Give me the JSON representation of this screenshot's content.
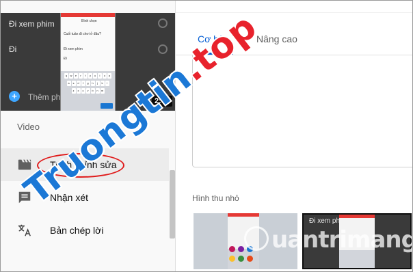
{
  "video_preview": {
    "duration": "2:09",
    "bg_title": "Đi xem phim",
    "bg_text": "Đi",
    "add_label": "Thêm phim",
    "phone": {
      "header": "Bình chọn",
      "question": "Cuối tuần đi chơi ở đâu?",
      "option1": "Đi xem phim",
      "option2": "Đi"
    }
  },
  "sidebar": {
    "section_label": "Video",
    "items": [
      {
        "label": "Trình chỉnh sửa",
        "icon": "clapperboard-icon",
        "active": true
      },
      {
        "label": "Nhận xét",
        "icon": "comment-icon",
        "active": false
      },
      {
        "label": "Bản chép lời",
        "icon": "translate-icon",
        "active": false
      }
    ]
  },
  "tabs": [
    {
      "label": "Cơ bản",
      "active": true
    },
    {
      "label": "Nâng cao",
      "active": false
    }
  ],
  "thumbnails": {
    "label": "Hình thu nhỏ",
    "option2_title": "Đi xem phim"
  },
  "watermark": {
    "main": "Truongtin",
    "suffix": ".top",
    "secondary": "uantrimang"
  },
  "colors": {
    "accent": "#065fd4",
    "highlight": "#e01b1b"
  }
}
